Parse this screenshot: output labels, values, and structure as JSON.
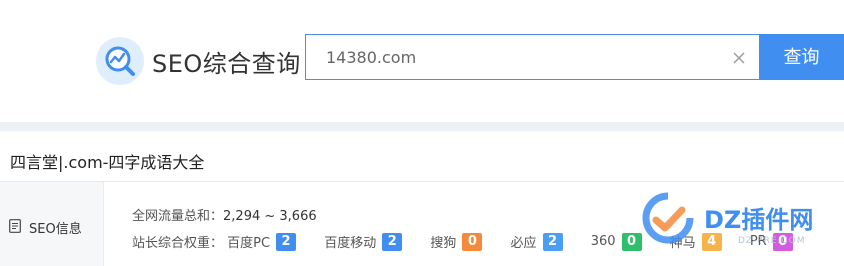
{
  "header": {
    "logo_text": "SEO综合查询",
    "logo_icon": "chart-line-magnifier-icon",
    "search": {
      "value": "14380.com",
      "placeholder": ""
    },
    "search_button_label": "查询"
  },
  "site": {
    "title": "四言堂|.com-四字成语大全"
  },
  "seo_info": {
    "side_label": "SEO信息",
    "traffic_label": "全网流量总和：",
    "traffic_value": "2,294 ~ 3,666",
    "weights_label": "站长综合权重：",
    "weights": [
      {
        "name": "百度PC",
        "value": "2",
        "color": "#3f8ef0"
      },
      {
        "name": "百度移动",
        "value": "2",
        "color": "#3f8ef0"
      },
      {
        "name": "搜狗",
        "value": "0",
        "color": "#f58a3c"
      },
      {
        "name": "必应",
        "value": "2",
        "color": "#4a9ff5"
      },
      {
        "name": "360",
        "value": "0",
        "color": "#2fbf6a"
      },
      {
        "name": "神马",
        "value": "4",
        "color": "#f5b34a"
      },
      {
        "name": "PR",
        "value": "0",
        "color": "#d65ae0"
      }
    ]
  },
  "watermark": {
    "text": "DZ插件网",
    "sub": "DZ-PRE.COM"
  },
  "colors": {
    "accent": "#3f8ef0",
    "band": "#edf1f6"
  }
}
